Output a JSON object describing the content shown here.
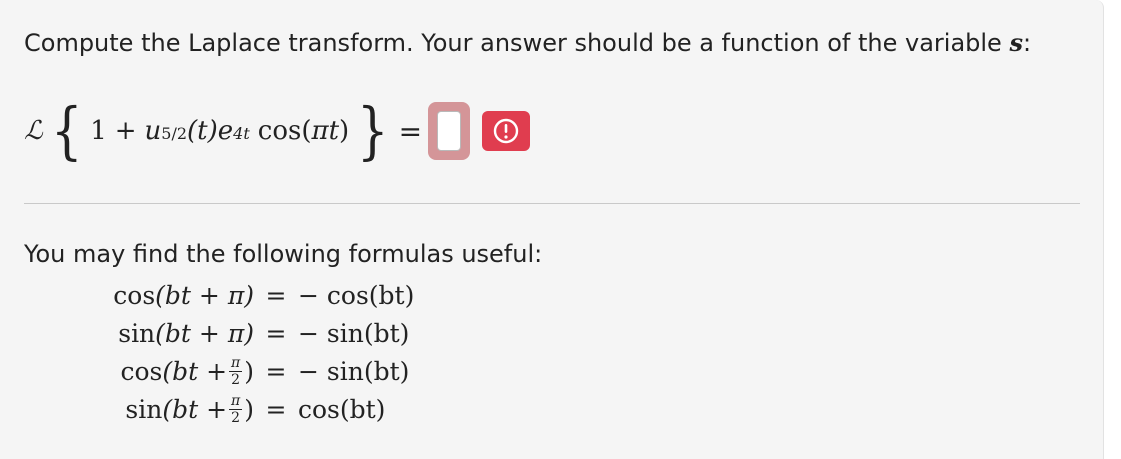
{
  "question": {
    "prompt": "Compute the Laplace transform. Your answer should be a function of the variable",
    "variable": "s",
    "prompt_end": ":"
  },
  "equation": {
    "operator": "ℒ",
    "left_brace": "{",
    "right_brace": "}",
    "term1": "1",
    "plus": "+",
    "u": "u",
    "u_sub": "5/2",
    "u_arg": "(t)",
    "e": "e",
    "e_sup": "4t",
    "cos": "cos(",
    "pi_t": "πt",
    "close": ")",
    "equals": "="
  },
  "answer_input": {
    "value": ""
  },
  "formulas": {
    "title": "You may find the following formulas useful:",
    "rows": [
      {
        "f": "cos",
        "arg_pre": "(bt + π)",
        "has_frac": false,
        "eq": "=",
        "rhs": "− cos(bt)"
      },
      {
        "f": "sin",
        "arg_pre": "(bt + π)",
        "has_frac": false,
        "eq": "=",
        "rhs": "− sin(bt)"
      },
      {
        "f": "cos",
        "arg_pre": "(bt + ",
        "frac_num": "π",
        "frac_den": "2",
        "arg_post": ")",
        "has_frac": true,
        "eq": "=",
        "rhs": "− sin(bt)"
      },
      {
        "f": "sin",
        "arg_pre": "(bt + ",
        "frac_num": "π",
        "frac_den": "2",
        "arg_post": ")",
        "has_frac": true,
        "eq": "=",
        "rhs": "cos(bt)"
      }
    ]
  },
  "colors": {
    "answer_box_border": "#d49598",
    "warning_button": "#e03d4f"
  }
}
